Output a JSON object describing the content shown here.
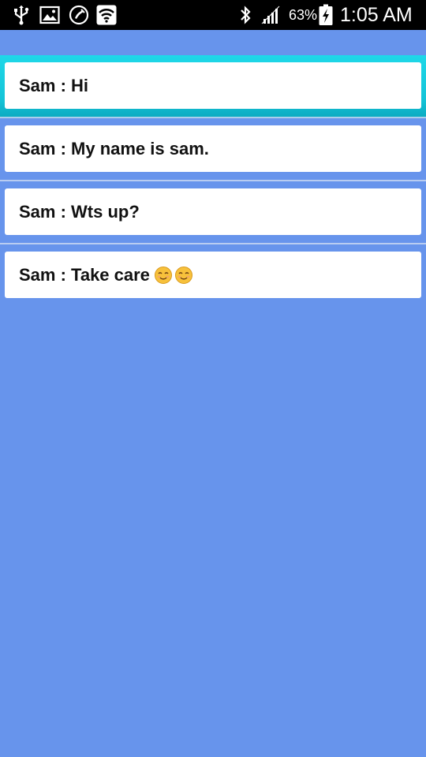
{
  "status_bar": {
    "battery_percent": "63%",
    "time": "1:05 AM",
    "icons": [
      "usb-icon",
      "image-icon",
      "call-icon",
      "wifi-icon",
      "bluetooth-icon",
      "signal-icon",
      "battery-charging-icon"
    ]
  },
  "messages": [
    {
      "text": "Sam : Hi",
      "selected": true,
      "emoji": []
    },
    {
      "text": "Sam : My name is sam.",
      "selected": false,
      "emoji": []
    },
    {
      "text": "Sam : Wts up?",
      "selected": false,
      "emoji": []
    },
    {
      "text": "Sam : Take care",
      "selected": false,
      "emoji": [
        "smiling-face-emoji",
        "smiling-face-emoji"
      ]
    }
  ],
  "colors": {
    "background": "#6794ec",
    "selected_highlight": "#1fd8e8",
    "card": "#ffffff"
  }
}
